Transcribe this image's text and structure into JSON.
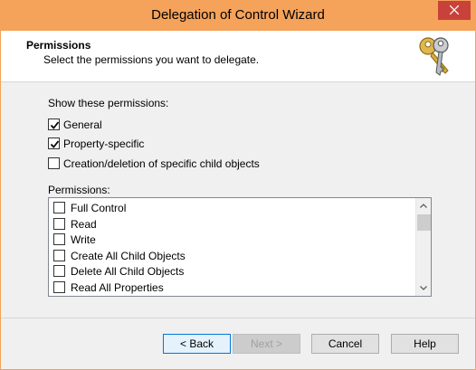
{
  "window": {
    "title": "Delegation of Control Wizard"
  },
  "header": {
    "title": "Permissions",
    "subtitle": "Select the permissions you want to delegate."
  },
  "show_permissions": {
    "label": "Show these permissions:",
    "options": [
      {
        "label": "General",
        "checked": true
      },
      {
        "label": "Property-specific",
        "checked": true
      },
      {
        "label": "Creation/deletion of specific child objects",
        "checked": false
      }
    ]
  },
  "permissions": {
    "label": "Permissions:",
    "items": [
      {
        "label": "Full Control",
        "checked": false
      },
      {
        "label": "Read",
        "checked": false
      },
      {
        "label": "Write",
        "checked": false
      },
      {
        "label": "Create All Child Objects",
        "checked": false
      },
      {
        "label": "Delete All Child Objects",
        "checked": false
      },
      {
        "label": "Read All Properties",
        "checked": false
      }
    ]
  },
  "buttons": {
    "back": "< Back",
    "next": "Next >",
    "cancel": "Cancel",
    "help": "Help"
  },
  "colors": {
    "titlebar": "#f5a25a",
    "close": "#c8413b",
    "focus_border": "#0078d7"
  }
}
